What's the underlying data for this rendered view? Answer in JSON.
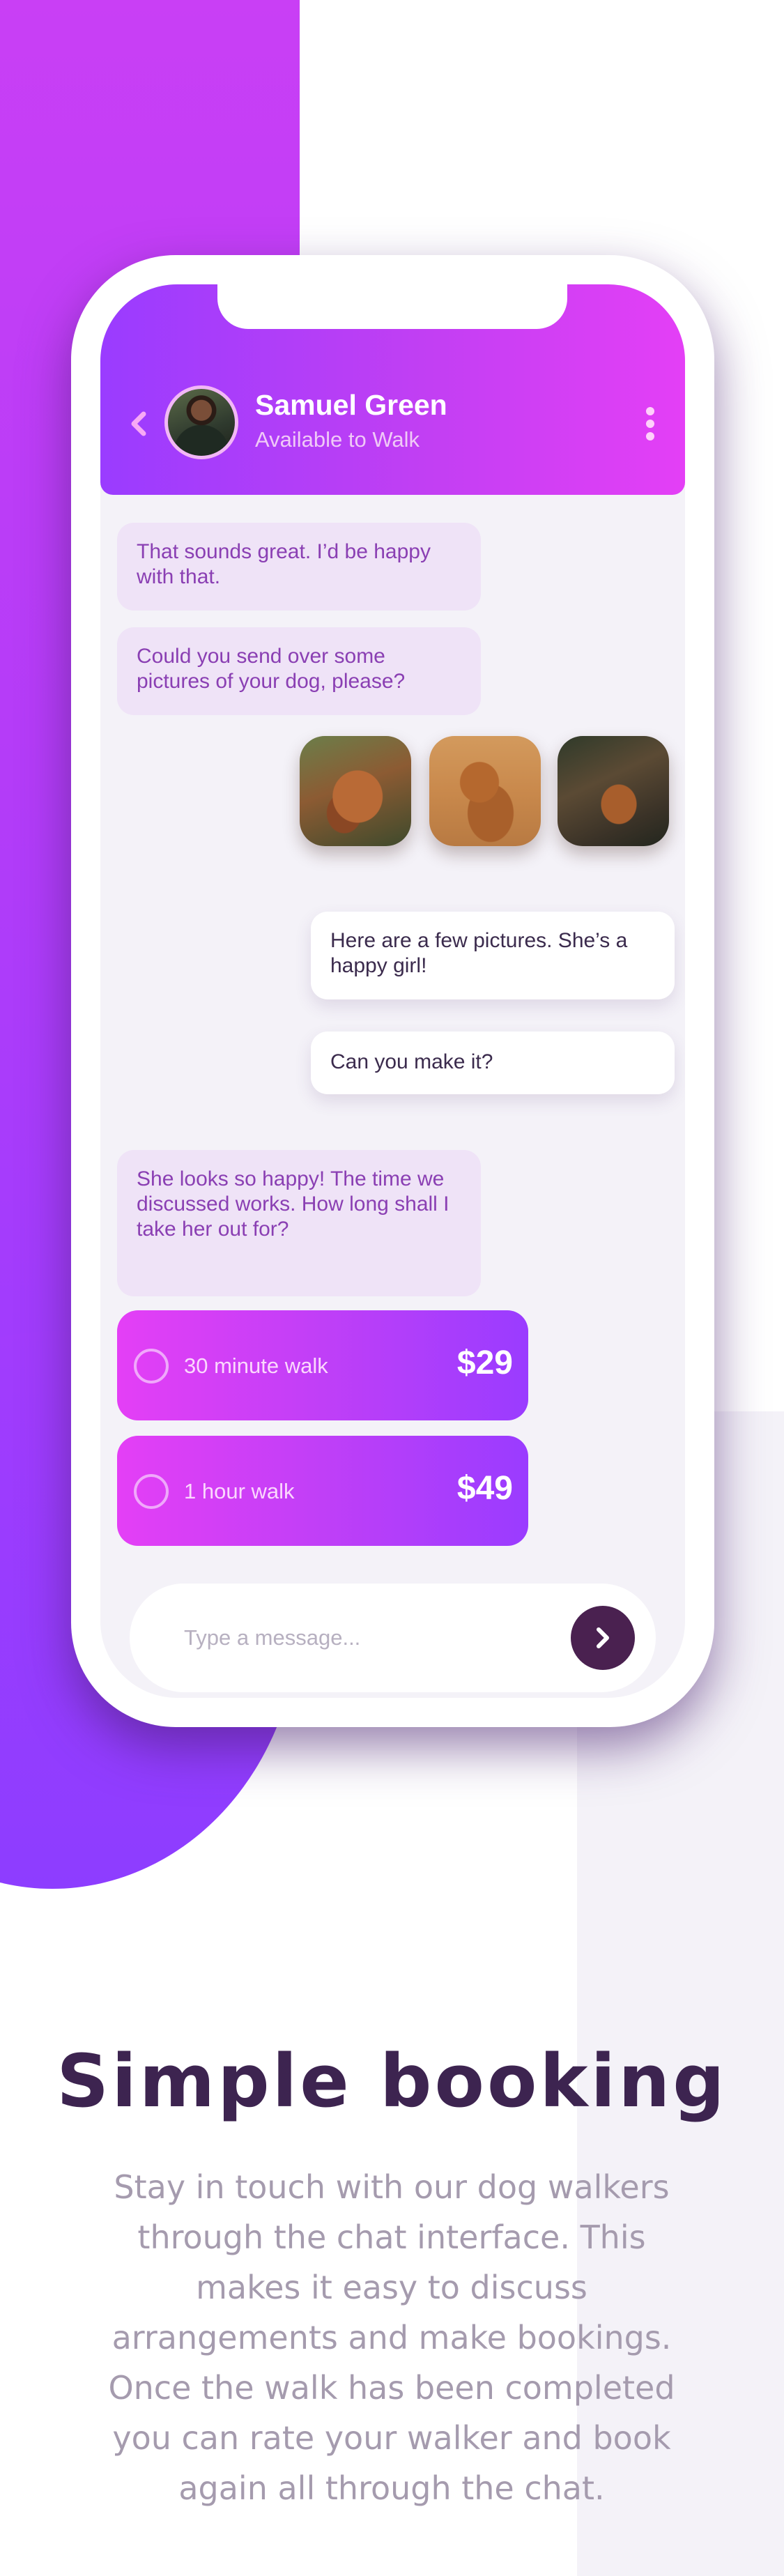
{
  "header": {
    "contact_name": "Samuel Green",
    "contact_status": "Available to Walk"
  },
  "messages": [
    {
      "from": "walker",
      "text": "That sounds great. I’d be happy with that."
    },
    {
      "from": "walker",
      "text": "Could you send over some pictures of your dog, please?"
    },
    {
      "from": "owner",
      "text": "Here are a few pictures. She’s a happy girl!"
    },
    {
      "from": "owner",
      "text": "Can you make it?"
    },
    {
      "from": "walker",
      "text": "She looks so happy! The time we discussed works. How long shall I take her out for?"
    }
  ],
  "booking_options": [
    {
      "label": "30 minute walk",
      "price": "$29"
    },
    {
      "label": "1 hour walk",
      "price": "$49"
    }
  ],
  "composer": {
    "placeholder": "Type a message..."
  },
  "feature": {
    "title": "Simple booking",
    "description_lines": [
      "Stay in touch with our dog walkers",
      "through the chat interface. This",
      "makes it easy to discuss",
      "arrangements and make bookings.",
      "Once the walk has been completed",
      "you can rate your walker and book",
      "again all through the chat."
    ]
  },
  "colors": {
    "accent_purple": "#9a3cff",
    "accent_magenta": "#e43ff6",
    "dark_plum": "#4a2150",
    "headline": "#3d2450",
    "body_text": "#a59bae"
  }
}
